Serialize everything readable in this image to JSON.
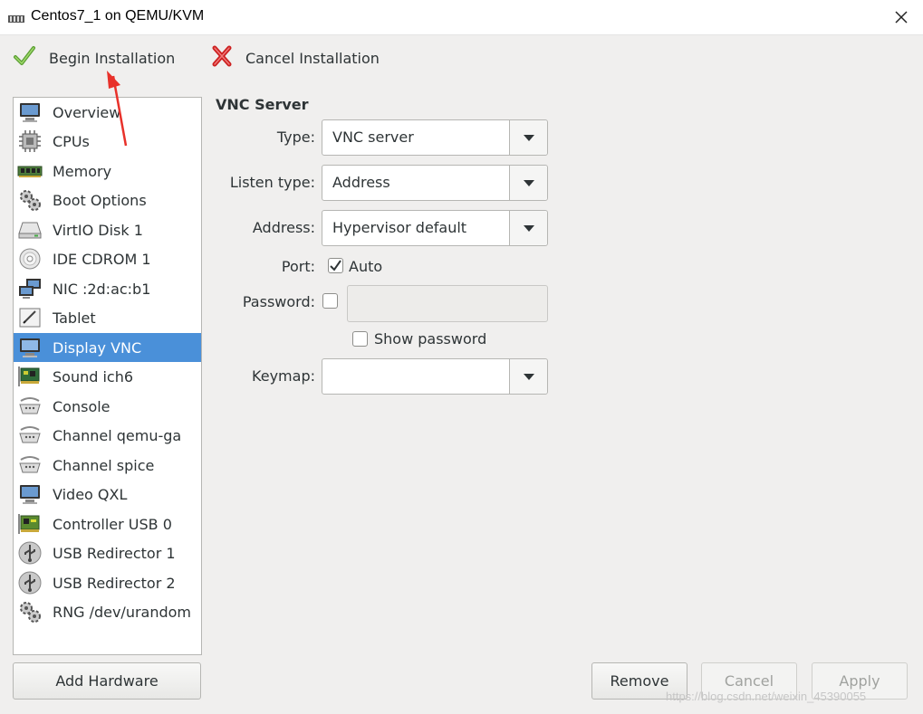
{
  "window": {
    "title": "Centos7_1 on QEMU/KVM"
  },
  "toolbar": {
    "begin_label": "Begin Installation",
    "cancel_label": "Cancel Installation"
  },
  "sidebar": {
    "items": [
      {
        "label": "Overview",
        "icon": "monitor-icon"
      },
      {
        "label": "CPUs",
        "icon": "cpu-chip-icon"
      },
      {
        "label": "Memory",
        "icon": "memory-module-icon"
      },
      {
        "label": "Boot Options",
        "icon": "gears-icon"
      },
      {
        "label": "VirtIO Disk 1",
        "icon": "hard-disk-icon"
      },
      {
        "label": "IDE CDROM 1",
        "icon": "cdrom-icon"
      },
      {
        "label": "NIC :2d:ac:b1",
        "icon": "network-icon"
      },
      {
        "label": "Tablet",
        "icon": "tablet-icon"
      },
      {
        "label": "Display VNC",
        "icon": "monitor-icon",
        "selected": true
      },
      {
        "label": "Sound ich6",
        "icon": "sound-card-icon"
      },
      {
        "label": "Console",
        "icon": "serial-icon"
      },
      {
        "label": "Channel qemu-ga",
        "icon": "serial-icon"
      },
      {
        "label": "Channel spice",
        "icon": "serial-icon"
      },
      {
        "label": "Video QXL",
        "icon": "monitor-icon"
      },
      {
        "label": "Controller USB 0",
        "icon": "controller-card-icon"
      },
      {
        "label": "USB Redirector 1",
        "icon": "usb-icon"
      },
      {
        "label": "USB Redirector 2",
        "icon": "usb-icon"
      },
      {
        "label": "RNG /dev/urandom",
        "icon": "gears-icon"
      }
    ],
    "add_hardware_label": "Add Hardware"
  },
  "vnc": {
    "section_title": "VNC Server",
    "type_label": "Type:",
    "type_value": "VNC server",
    "listen_type_label": "Listen type:",
    "listen_type_value": "Address",
    "address_label": "Address:",
    "address_value": "Hypervisor default",
    "port_label": "Port:",
    "port_auto_label": "Auto",
    "port_auto_checked": true,
    "password_label": "Password:",
    "password_checked": false,
    "password_value": "",
    "show_password_label": "Show password",
    "show_password_checked": false,
    "keymap_label": "Keymap:",
    "keymap_value": ""
  },
  "footer": {
    "remove_label": "Remove",
    "cancel_label": "Cancel",
    "apply_label": "Apply"
  },
  "watermark": "https://blog.csdn.net/weixin_45390055",
  "colors": {
    "selection": "#4a90d9",
    "annotation_arrow": "#e8312a"
  }
}
